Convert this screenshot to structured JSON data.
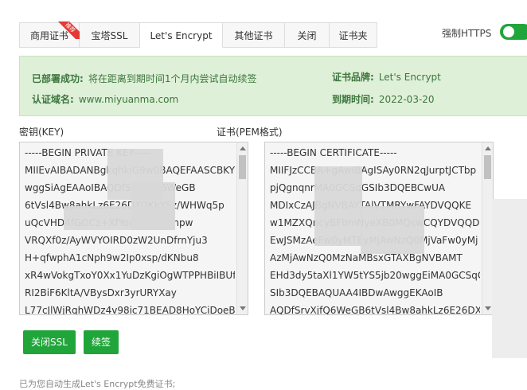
{
  "tabs": [
    {
      "label": "商用证书",
      "badge": "推荐"
    },
    {
      "label": "宝塔SSL"
    },
    {
      "label": "Let's Encrypt"
    },
    {
      "label": "其他证书"
    },
    {
      "label": "关闭"
    },
    {
      "label": "证书夹"
    }
  ],
  "force_https": {
    "label": "强制HTTPS",
    "enabled": true
  },
  "info": {
    "deployed_label": "已部署成功:",
    "deployed_value": "将在距离到期时间1个月内尝试自动续签",
    "domain_label": "认证域名:",
    "domain_value": "www.miyuanma.com",
    "brand_label": "证书品牌:",
    "brand_value": "Let's Encrypt",
    "expiry_label": "到期时间:",
    "expiry_value": "2022-03-20"
  },
  "key_label": "密钥(KEY)",
  "cert_label": "证书(PEM格式)",
  "key_lines": [
    "-----BEGIN PRIVATE KEY-----",
    "MIIEvAIBADANBgkqhkiG9w0BAQEFAASCBKY",
    "wggSiAgEAAoIBAQDfSrvXjfQ6WeGB",
    "6tVsl4Bw8ahkLz6E26DXOKkYSz/WHWq5p",
    "uQcVHD4fGOCz+XfYoqhsQrKmhpw",
    "VRQXf0z/AyWVYOIRD0zW2UnDfrnYju3",
    "H+qfwphA1cNph9w2Ip0xsp/dKNbu8",
    "xR4wVokgTxoY0Xx1YuDzKgiOgWTPPHBiIBUf",
    "RI2BiF6KltA/VBysDxr3yrURYXay",
    "L77cJlWjRqhWDz4v98ic71BEAD8HoYCiDoeBj"
  ],
  "cert_lines": [
    "-----BEGIN CERTIFICATE-----",
    "MIIFJzCCBA+gAwIBAgISAy0RN2qJurptJCTbp",
    "pjQgnqnrMA0GCSqGSIb3DQEBCwUA",
    "MDIxCzAJBgNVBAYTAlVTMRYwFAYDVQQKE",
    "w1MZXQncyBFbmNyeXB0MQswCQYDVQQD",
    "EwJSMzAeFw0yMTEyMjAwNzQ0MjVaFw0yMj",
    "AzMjAwNzQ0MzNaMBsxGTAXBgNVBAMT",
    "EHd3dy5taXl1YW5tYS5jb20wggEiMA0GCSqG",
    "SIb3DQEBAQUAA4IBDwAwggEKAoIB",
    "AQDfSrvXjfQ6WeGB6tVsl4Bw8ahkLz6E26DX"
  ],
  "buttons": {
    "close_ssl": "关闭SSL",
    "renew": "续签"
  },
  "bottom_note": "已为您自动生成Let's Encrypt免费证书;"
}
